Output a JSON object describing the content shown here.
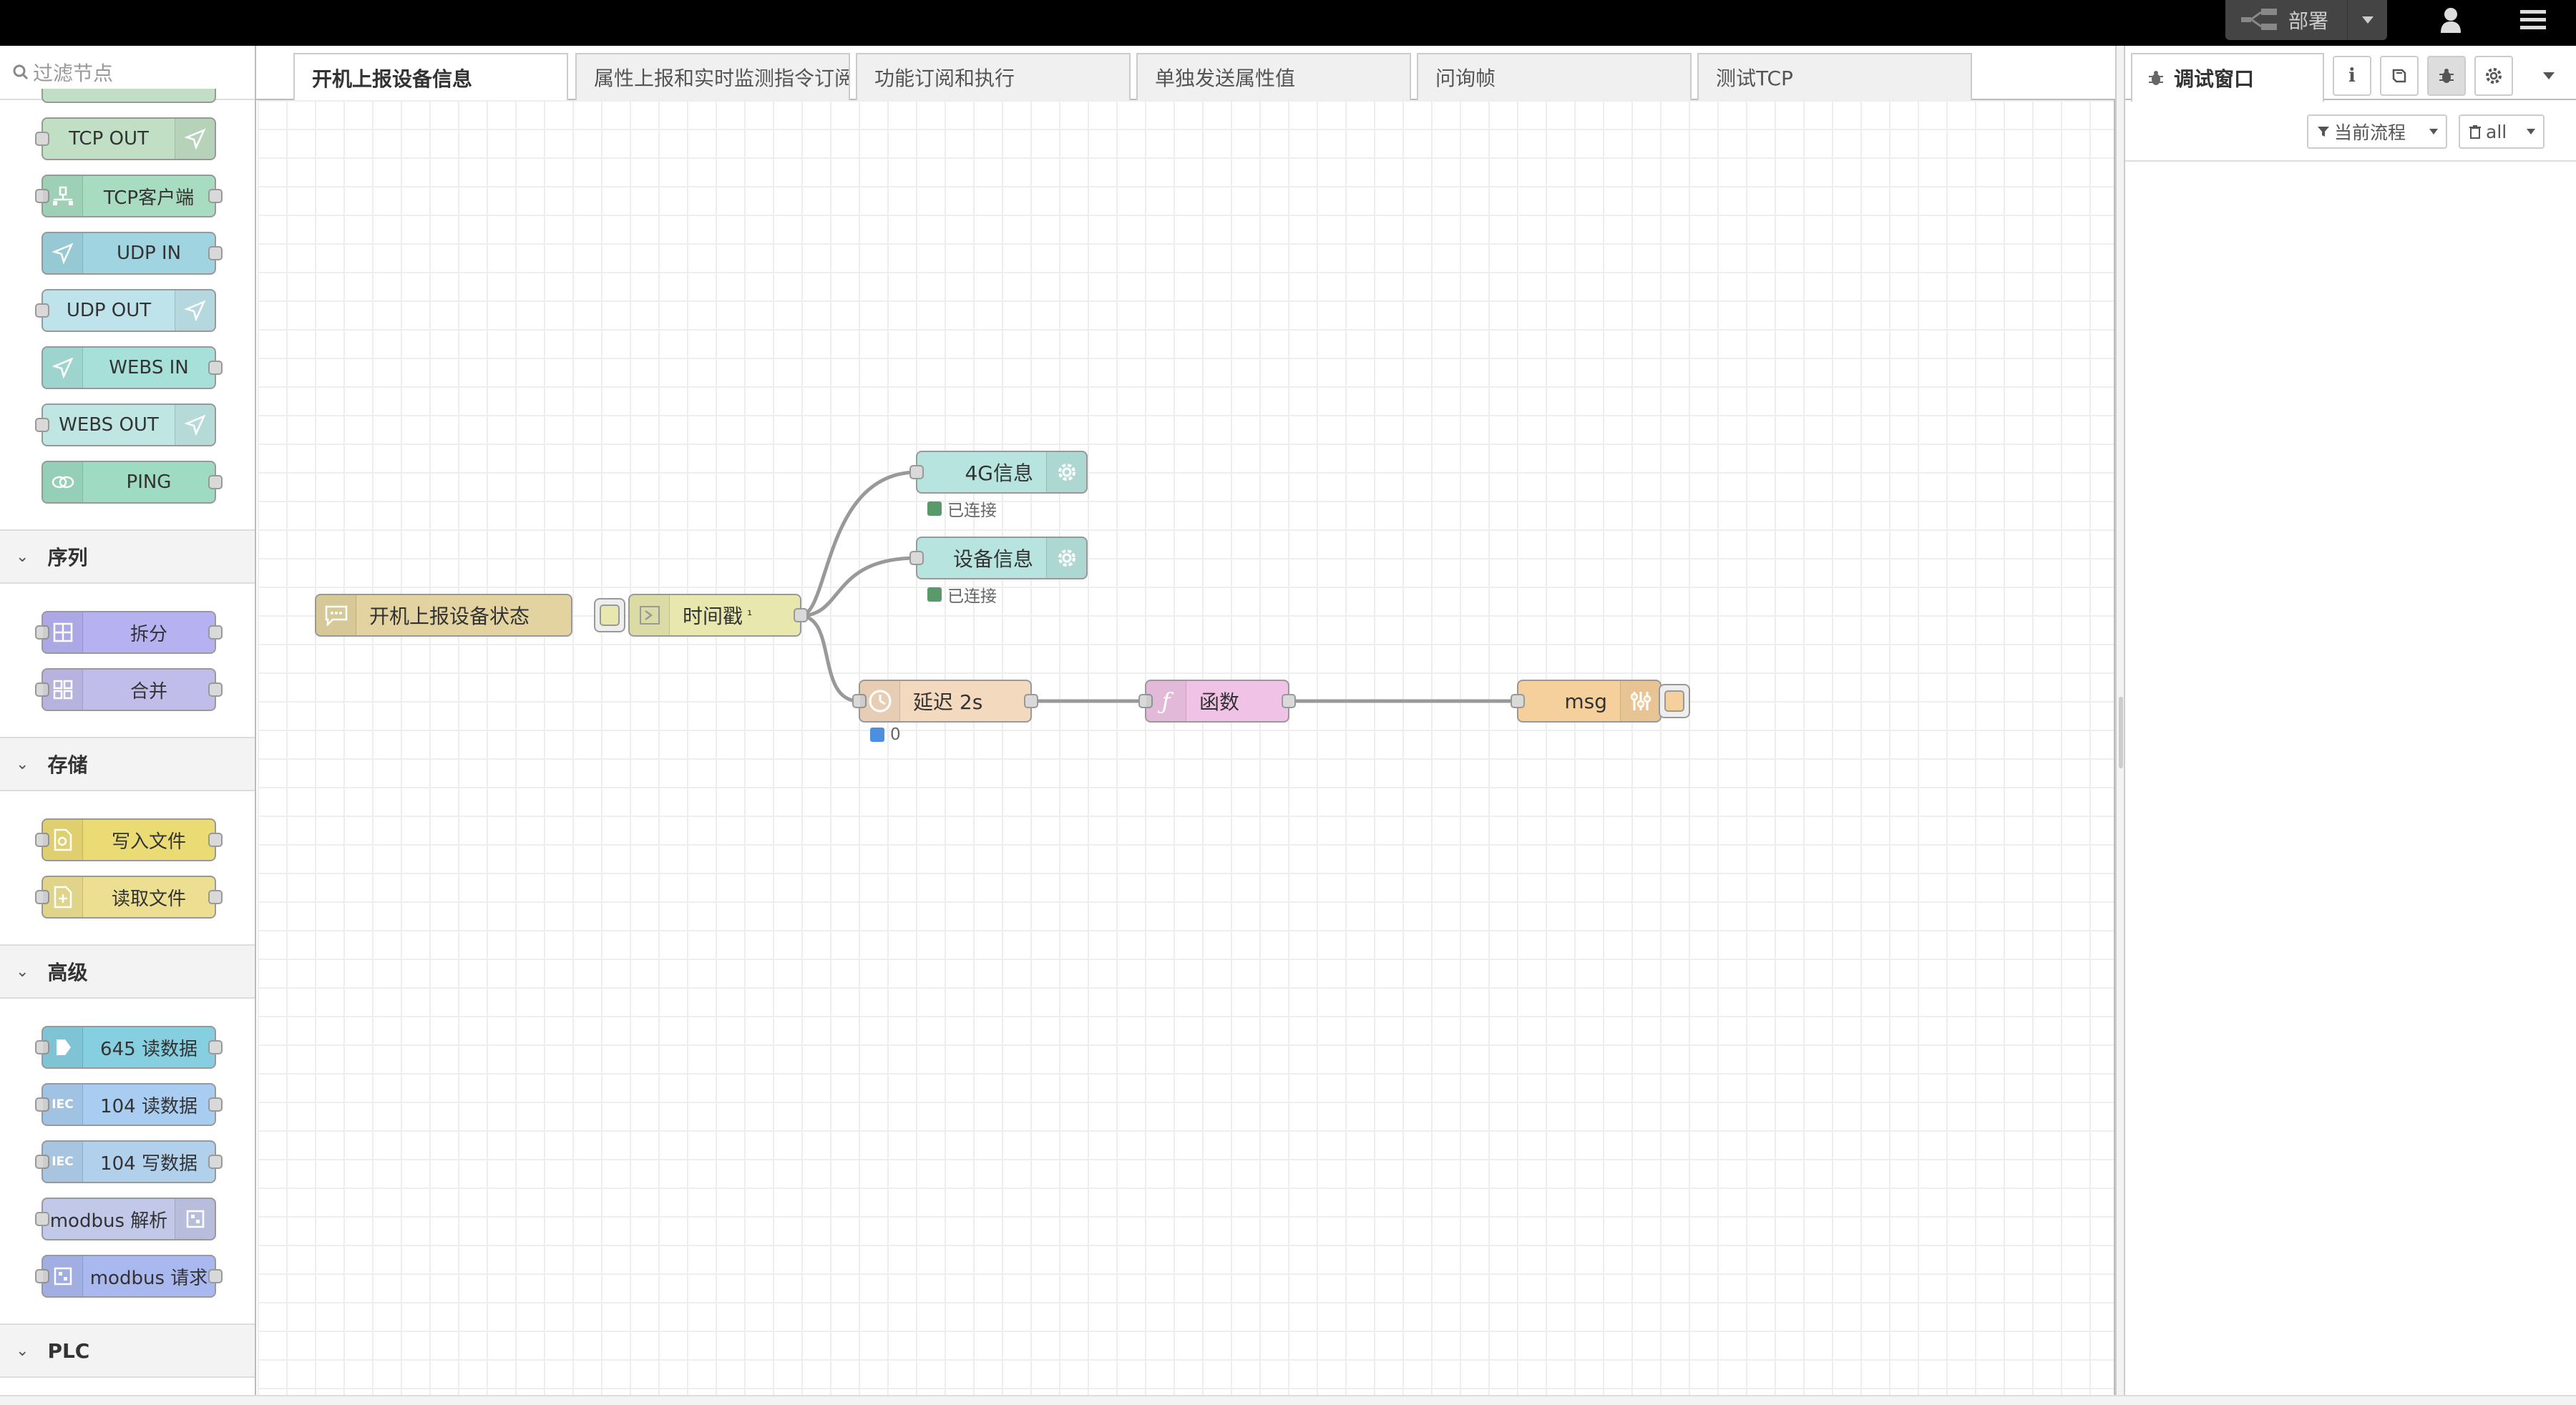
{
  "header": {
    "deploy_label": "部署"
  },
  "palette": {
    "filter_placeholder": "过滤节点",
    "nodes_network": [
      {
        "label": "TCP OUT",
        "color": "#c0dfc5"
      },
      {
        "label": "TCP客户端",
        "color": "#a7dcc0"
      },
      {
        "label": "UDP IN",
        "color": "#9fd4e0"
      },
      {
        "label": "UDP OUT",
        "color": "#bfe3ea"
      },
      {
        "label": "WEBS IN",
        "color": "#a6e0d8"
      },
      {
        "label": "WEBS OUT",
        "color": "#bfe6e3"
      },
      {
        "label": "PING",
        "color": "#9edbc2"
      }
    ],
    "category_sequence": "序列",
    "nodes_sequence": [
      {
        "label": "拆分",
        "color": "#b6b2f2"
      },
      {
        "label": "合并",
        "color": "#c0bdea"
      }
    ],
    "category_storage": "存储",
    "nodes_storage": [
      {
        "label": "写入文件",
        "color": "#ebdb74"
      },
      {
        "label": "读取文件",
        "color": "#ecdf92"
      }
    ],
    "category_advanced": "高级",
    "nodes_advanced": [
      {
        "label": "645 读数据",
        "color": "#86cfe0"
      },
      {
        "label": "104 读数据",
        "color": "#a9cdf0"
      },
      {
        "label": "104 写数据",
        "color": "#b0d0ec"
      },
      {
        "label": "modbus 解析",
        "color": "#c2c8e8"
      },
      {
        "label": "modbus 请求",
        "color": "#a9b8ee"
      }
    ],
    "category_plc": "PLC"
  },
  "tabs": [
    {
      "label": "开机上报设备信息",
      "active": true
    },
    {
      "label": "属性上报和实时监测指令订阅",
      "active": false
    },
    {
      "label": "功能订阅和执行",
      "active": false
    },
    {
      "label": "单独发送属性值",
      "active": false
    },
    {
      "label": "问询帧",
      "active": false
    },
    {
      "label": "测试TCP",
      "active": false
    }
  ],
  "flow": {
    "comment_node": "开机上报设备状态",
    "inject_node": "时间戳",
    "inject_sup": "¹",
    "node_4g": "4G信息",
    "node_4g_status": "已连接",
    "node_device": "设备信息",
    "node_device_status": "已连接",
    "delay_node": "延迟 2s",
    "delay_status": "0",
    "function_node": "函数",
    "debug_node": "msg",
    "colors": {
      "comment": "#e2d3a0",
      "inject": "#e7e7ae",
      "mqtt": "#b7e4de",
      "delay": "#f3d9be",
      "function": "#f0c3e6",
      "debug": "#f5cf9c",
      "status_connected": "#5a9a6a",
      "status_delay": "#4a8fe0"
    }
  },
  "sidebar": {
    "tab_debug": "调试窗口",
    "filter_label": "当前流程",
    "clear_label": "all"
  }
}
